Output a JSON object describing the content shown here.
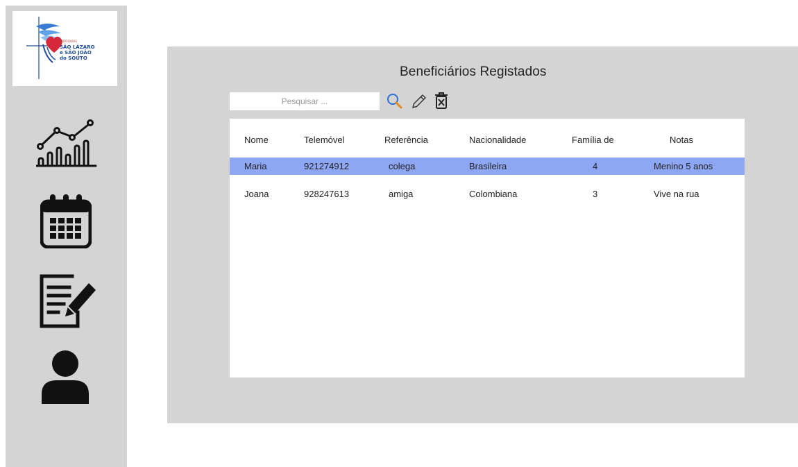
{
  "sidebar": {
    "logo": {
      "line1": "PARÓQUIAS",
      "line2": "SÃO LÁZARO",
      "line3": "e SÃO JOÃO",
      "line4": "do SOUTO"
    },
    "nav": [
      {
        "name": "statistics",
        "icon": "chart-icon"
      },
      {
        "name": "calendar",
        "icon": "calendar-icon"
      },
      {
        "name": "registration",
        "icon": "form-edit-icon"
      },
      {
        "name": "profile",
        "icon": "user-icon"
      }
    ]
  },
  "main": {
    "title": "Beneficiários Registados",
    "search": {
      "placeholder": "Pesquisar ...",
      "value": ""
    },
    "tools": [
      "search-icon",
      "edit-icon",
      "delete-icon"
    ],
    "table": {
      "columns": [
        "Nome",
        "Telemóvel",
        "Referência",
        "Nacionalidade",
        "Família de",
        "Notas"
      ],
      "rows": [
        [
          "Maria",
          "921274912",
          "colega",
          "Brasileira",
          "4",
          "Menino 5 anos"
        ],
        [
          "Joana",
          "928247613",
          "amiga",
          "Colombiana",
          "3",
          "Vive na rua"
        ]
      ],
      "selected_row": 0
    }
  },
  "colors": {
    "sidebar_bg": "#d4d4d4",
    "selected_row": "#8ea7f5",
    "logo_blue": "#1f4e9a",
    "logo_red": "#d6283a",
    "search_icon": "#e08a1e"
  }
}
